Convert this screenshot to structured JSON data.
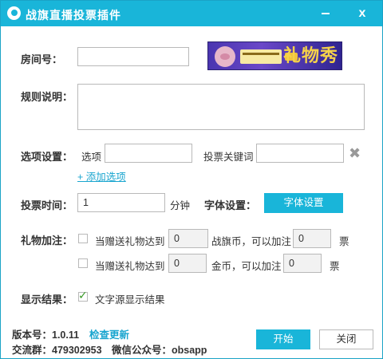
{
  "window": {
    "title": "战旗直播投票插件",
    "accent": "#19b5d9"
  },
  "titlebar": {
    "minimize_icon": "minimize-icon",
    "close_icon": "close-icon",
    "close_glyph": "x"
  },
  "room": {
    "label": "房间号：",
    "value": ""
  },
  "banner": {
    "text": "礼物秀"
  },
  "rules": {
    "label": "规则说明：",
    "value": ""
  },
  "options": {
    "label": "选项设置：",
    "option_label": "选项",
    "option_value": "",
    "keyword_label": "投票关键词",
    "keyword_value": "",
    "add_link": "+ 添加选项"
  },
  "vote_time": {
    "label": "投票时间：",
    "value": "1",
    "unit": "分钟"
  },
  "font": {
    "label": "字体设置：",
    "button": "字体设置"
  },
  "gift": {
    "label": "礼物加注：",
    "rows": [
      {
        "checked": false,
        "prefix": "当赠送礼物达到",
        "amount": "0",
        "middle": "战旗币，可以加注",
        "votes": "0",
        "suffix": "票"
      },
      {
        "checked": false,
        "prefix": "当赠送礼物达到",
        "amount": "0",
        "middle": "金币，可以加注",
        "votes": "0",
        "suffix": "票"
      }
    ]
  },
  "display": {
    "label": "显示结果：",
    "checked": true,
    "option": "文字源显示结果"
  },
  "footer": {
    "version": "版本号：1.0.11",
    "check_update": "检查更新",
    "group": "交流群：479302953",
    "wechat": "微信公众号：obsapp",
    "start_button": "开始",
    "close_button": "关闭"
  }
}
